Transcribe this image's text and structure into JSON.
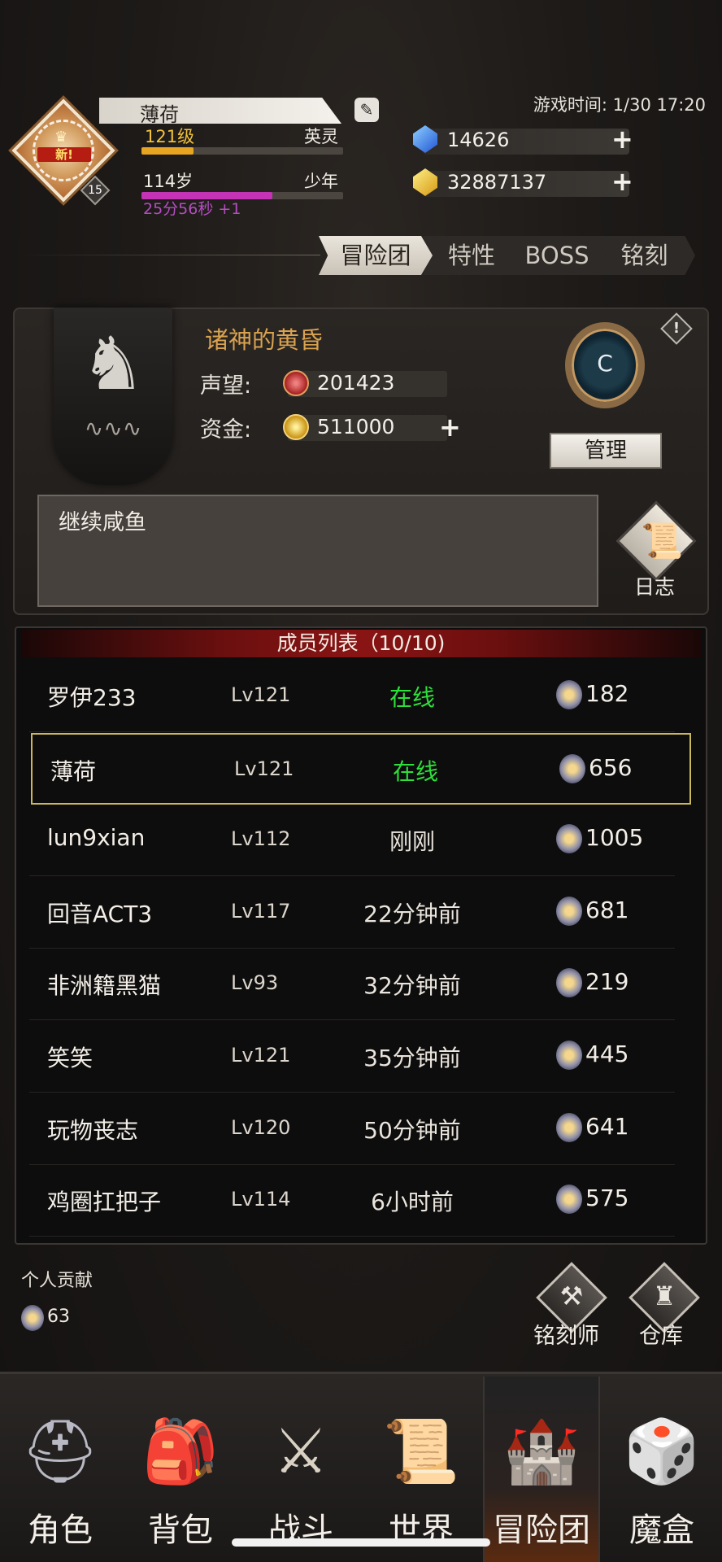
{
  "header": {
    "game_time": "游戏时间: 1/30 17:20",
    "badge_new": "新!",
    "badge_level": "15",
    "player_name": "薄荷",
    "level_text": "121级",
    "rank_title": "英灵",
    "age_text": "114岁",
    "age_stage": "少年",
    "age_timer": "25分56秒 +1",
    "level_progress": 0.26,
    "age_progress": 0.65,
    "currency_gem": "14626",
    "currency_gold": "32887137"
  },
  "tabs": [
    {
      "label": "冒险团",
      "active": true
    },
    {
      "label": "特性",
      "active": false
    },
    {
      "label": "BOSS",
      "active": false
    },
    {
      "label": "铭刻",
      "active": false
    }
  ],
  "guild": {
    "name": "诸神的黄昏",
    "prestige_label": "声望:",
    "prestige_value": "201423",
    "funds_label": "资金:",
    "funds_value": "511000",
    "crest_letter": "C",
    "manage_label": "管理",
    "notice": "继续咸鱼",
    "log_label": "日志"
  },
  "members": {
    "title": "成员列表（10/10)",
    "rows": [
      {
        "name": "罗伊233",
        "level": "Lv121",
        "status": "在线",
        "online": true,
        "score": "182"
      },
      {
        "name": "薄荷",
        "level": "Lv121",
        "status": "在线",
        "online": true,
        "score": "656",
        "selected": true
      },
      {
        "name": "lun9xian",
        "level": "Lv112",
        "status": "刚刚",
        "online": false,
        "score": "1005"
      },
      {
        "name": "回音ACT3",
        "level": "Lv117",
        "status": "22分钟前",
        "online": false,
        "score": "681"
      },
      {
        "name": "非洲籍黑猫",
        "level": "Lv93",
        "status": "32分钟前",
        "online": false,
        "score": "219"
      },
      {
        "name": "笑笑",
        "level": "Lv121",
        "status": "35分钟前",
        "online": false,
        "score": "445"
      },
      {
        "name": "玩物丧志",
        "level": "Lv120",
        "status": "50分钟前",
        "online": false,
        "score": "641"
      },
      {
        "name": "鸡圈扛把子",
        "level": "Lv114",
        "status": "6小时前",
        "online": false,
        "score": "575"
      }
    ]
  },
  "footer": {
    "contribution_label": "个人贡献",
    "contribution_value": "63",
    "engraver_label": "铭刻师",
    "storage_label": "仓库"
  },
  "nav": [
    {
      "label": "角色",
      "icon": "helmet-icon"
    },
    {
      "label": "背包",
      "icon": "backpack-icon"
    },
    {
      "label": "战斗",
      "icon": "sword-shield-icon"
    },
    {
      "label": "世界",
      "icon": "scroll-map-icon"
    },
    {
      "label": "冒险团",
      "icon": "castle-icon",
      "active": true
    },
    {
      "label": "魔盒",
      "icon": "magic-box-icon"
    }
  ],
  "colors": {
    "online": "#2de03a",
    "accent_gold": "#d9a24f",
    "selected_border": "#c9b85c"
  }
}
